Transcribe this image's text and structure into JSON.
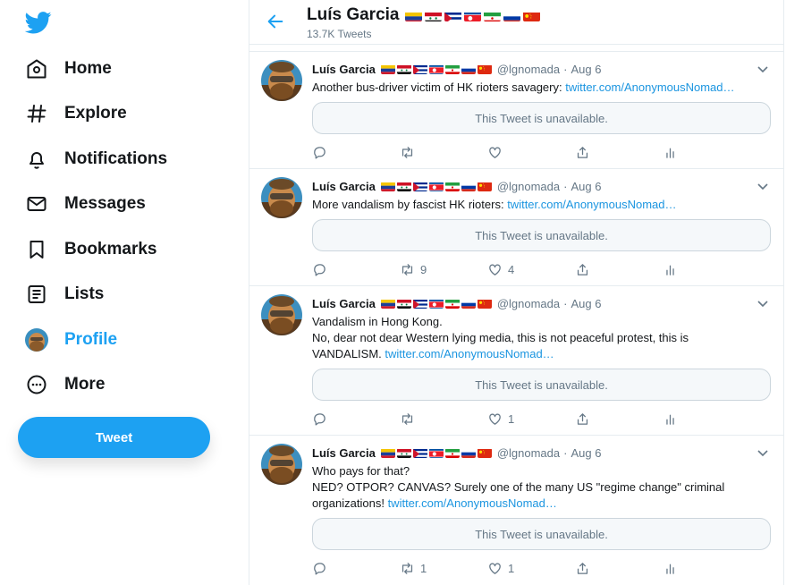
{
  "nav": {
    "items": [
      {
        "label": "Home",
        "icon": "home-icon"
      },
      {
        "label": "Explore",
        "icon": "hashtag-icon"
      },
      {
        "label": "Notifications",
        "icon": "bell-icon"
      },
      {
        "label": "Messages",
        "icon": "envelope-icon"
      },
      {
        "label": "Bookmarks",
        "icon": "bookmark-icon"
      },
      {
        "label": "Lists",
        "icon": "list-icon"
      },
      {
        "label": "Profile",
        "icon": "avatar",
        "active": true
      },
      {
        "label": "More",
        "icon": "more-icon"
      }
    ],
    "tweet_button": "Tweet"
  },
  "header": {
    "name": "Luís Garcia",
    "tweet_count": "13.7K Tweets",
    "flags": [
      "venezuela",
      "syria",
      "cuba",
      "north-korea",
      "iran",
      "russia",
      "china"
    ]
  },
  "colors": {
    "accent": "#1da1f2",
    "link": "#1b95e0",
    "muted": "#657786",
    "border": "#e6ecf0"
  },
  "tweets": [
    {
      "name": "Luís Garcia",
      "handle": "@lgnomada",
      "date": "Aug 6",
      "text": "Another bus-driver victim of HK rioters savagery: ",
      "link": "twitter.com/AnonymousNomad…",
      "quote": "This Tweet is unavailable.",
      "retweets": "",
      "likes": ""
    },
    {
      "name": "Luís Garcia",
      "handle": "@lgnomada",
      "date": "Aug 6",
      "text": "More vandalism by fascist HK rioters: ",
      "link": "twitter.com/AnonymousNomad…",
      "quote": "This Tweet is unavailable.",
      "retweets": "9",
      "likes": "4"
    },
    {
      "name": "Luís Garcia",
      "handle": "@lgnomada",
      "date": "Aug 6",
      "line1": "Vandalism in Hong Kong.",
      "line2": "No, dear not dear Western lying media, this is not peaceful protest, this is",
      "line3": "VANDALISM. ",
      "link": "twitter.com/AnonymousNomad…",
      "quote": "This Tweet is unavailable.",
      "retweets": "",
      "likes": "1"
    },
    {
      "name": "Luís Garcia",
      "handle": "@lgnomada",
      "date": "Aug 6",
      "line1": "Who pays for that?",
      "line2": "NED? OTPOR? CANVAS? Surely one of the many US \"regime change\" criminal",
      "line3": "organizations! ",
      "link": "twitter.com/AnonymousNomad…",
      "quote": "This Tweet is unavailable.",
      "retweets": "1",
      "likes": "1"
    }
  ]
}
